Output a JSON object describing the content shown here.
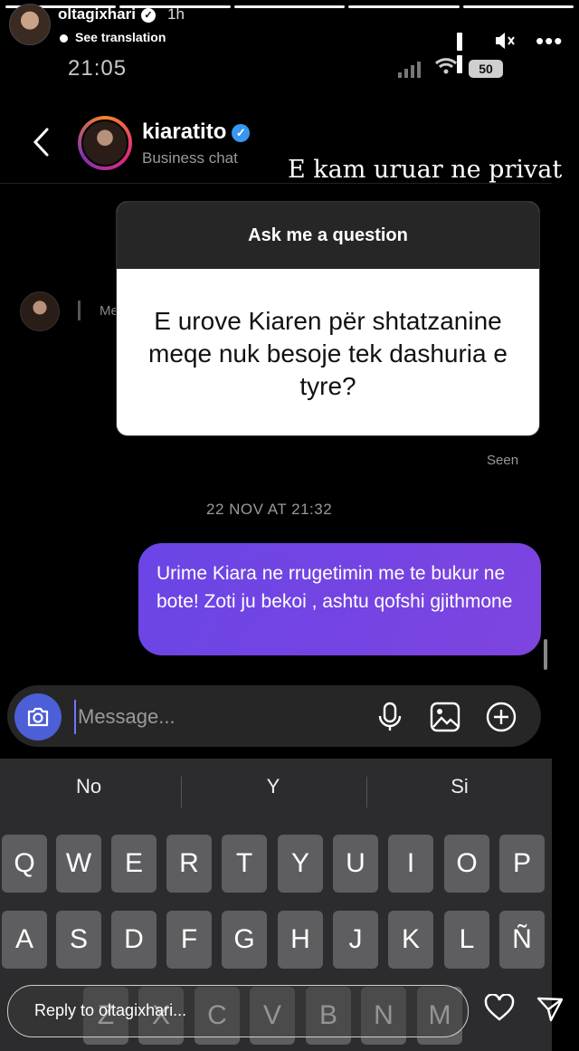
{
  "story": {
    "username": "oltagixhari",
    "time": "1h",
    "see_translation": "See translation",
    "reply_placeholder": "Reply to oltagixhari..."
  },
  "status_bar": {
    "clock": "21:05",
    "battery": "50"
  },
  "chat": {
    "name": "kiaratito",
    "subtitle": "Business chat",
    "left_message_stub": "Me",
    "seen": "Seen",
    "date_stamp": "22 NOV AT 21:32",
    "outgoing_message": "Urime Kiara ne rrugetimin me te bukur ne bote!  Zoti ju bekoi , ashtu qofshi gjithmone",
    "composer_placeholder": "Message..."
  },
  "overlay_caption": "E kam uruar ne privat",
  "question_card": {
    "header": "Ask me a question",
    "question": "E urove Kiaren për shtatzanine meqe nuk besoje tek dashuria e tyre?"
  },
  "keyboard": {
    "suggestions": [
      "No",
      "Y",
      "Si"
    ],
    "row1": [
      "Q",
      "W",
      "E",
      "R",
      "T",
      "Y",
      "U",
      "I",
      "O",
      "P"
    ],
    "row2": [
      "A",
      "S",
      "D",
      "F",
      "G",
      "H",
      "J",
      "K",
      "L",
      "Ñ"
    ],
    "row3": [
      "Z",
      "X",
      "C",
      "V",
      "B",
      "N",
      "M"
    ]
  },
  "icons": [
    "verified-badge-icon",
    "pause-icon",
    "mute-icon",
    "more-icon",
    "signal-icon",
    "wifi-icon",
    "back-icon",
    "camera-icon",
    "mic-icon",
    "gallery-icon",
    "plus-icon",
    "heart-icon",
    "send-icon"
  ],
  "colors": {
    "bubble": "#7048e8",
    "camera_button": "#4c5fd7",
    "verified": "#3897f0"
  }
}
